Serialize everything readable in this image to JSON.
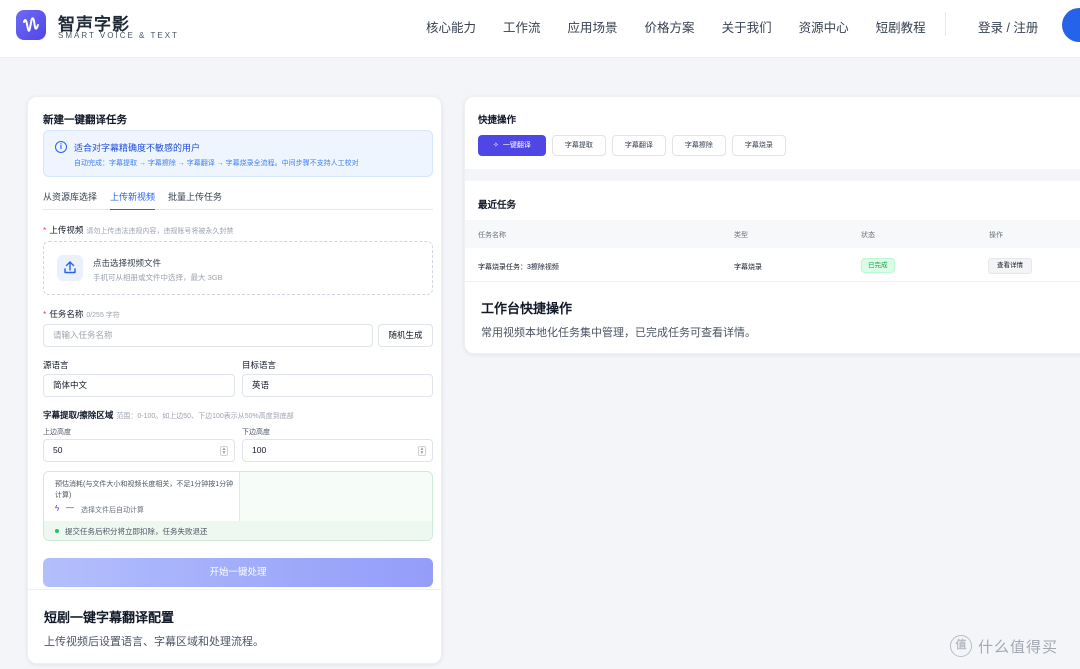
{
  "header": {
    "brand_name": "智声字影",
    "brand_sub": "SMART VOICE & TEXT",
    "nav": [
      "核心能力",
      "工作流",
      "应用场景",
      "价格方案",
      "关于我们",
      "资源中心",
      "短剧教程"
    ],
    "login": "登录 / 注册"
  },
  "left": {
    "title": "新建一键翻译任务",
    "info_title": "适合对字幕精确度不敏感的用户",
    "info_desc": "自动完成：字幕提取 → 字幕擦除 → 字幕翻译 → 字幕烧录全流程。中间步骤不支持人工校对",
    "tabs": [
      "从资源库选择",
      "上传新视频",
      "批量上传任务"
    ],
    "upload_label": "上传视频",
    "upload_hint": "请勿上传违法违规内容，违规账号将被永久封禁",
    "upload_title": "点击选择视频文件",
    "upload_desc": "手机可从相册或文件中选择，最大 3GB",
    "task_name_label": "任务名称",
    "task_name_hint": "0/255 字符",
    "task_name_placeholder": "请输入任务名称",
    "random_btn": "随机生成",
    "source_lang_label": "源语言",
    "source_lang_value": "简体中文",
    "target_lang_label": "目标语言",
    "target_lang_value": "英语",
    "region_label": "字幕提取/擦除区域",
    "region_hint": "范围：0-100。如上边50、下边100表示从50%高度到底部",
    "top_label": "上边高度",
    "top_value": "50",
    "bottom_label": "下边高度",
    "bottom_value": "100",
    "est_text": "预估消耗(与文件大小和视频长度相关，不足1分钟按1分钟计算)",
    "est_dash": "—",
    "est_calc": "选择文件后自动计算",
    "est_note": "提交任务后积分将立即扣除，任务失败退还",
    "start_btn": "开始一键处理",
    "caption_title": "短剧一键字幕翻译配置",
    "caption_desc": "上传视频后设置语言、字幕区域和处理流程。"
  },
  "right": {
    "quick_title": "快捷操作",
    "quick_buttons": [
      "一键翻译",
      "字幕提取",
      "字幕翻译",
      "字幕擦除",
      "字幕烧录"
    ],
    "recent_title": "最近任务",
    "columns": [
      "任务名称",
      "类型",
      "状态",
      "操作"
    ],
    "row": {
      "name": "字幕烧录任务：3擦除视频",
      "type": "字幕烧录",
      "status": "已完成",
      "action": "查看详情"
    },
    "caption_title": "工作台快捷操作",
    "caption_desc": "常用视频本地化任务集中管理，已完成任务可查看详情。"
  },
  "watermark": {
    "circle": "值",
    "text": "什么值得买"
  },
  "colors": {
    "primary": "#4f46e5",
    "link": "#2563eb",
    "success": "#16a34a"
  }
}
